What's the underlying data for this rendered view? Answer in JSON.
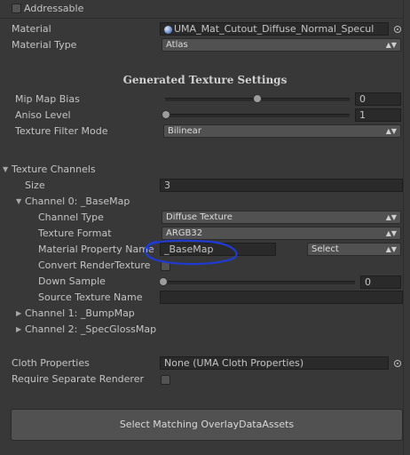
{
  "addressable": {
    "label": "Addressable",
    "checked": false
  },
  "material": {
    "label": "Material",
    "value": "UMA_Mat_Cutout_Diffuse_Normal_Specul",
    "icon": "material-sphere-icon"
  },
  "material_type": {
    "label": "Material Type",
    "value": "Atlas"
  },
  "generated_settings": {
    "title": "Generated Texture Settings",
    "mip_map_bias": {
      "label": "Mip Map Bias",
      "value": "0",
      "slider_fraction": 0.5
    },
    "aniso_level": {
      "label": "Aniso Level",
      "value": "1",
      "slider_fraction": 0.0
    },
    "texture_filter_mode": {
      "label": "Texture Filter Mode",
      "value": "Bilinear"
    }
  },
  "texture_channels": {
    "label": "Texture Channels",
    "size": {
      "label": "Size",
      "value": "3"
    },
    "channel0": {
      "label": "Channel 0: _BaseMap",
      "channel_type": {
        "label": "Channel Type",
        "value": "Diffuse Texture"
      },
      "texture_format": {
        "label": "Texture Format",
        "value": "ARGB32"
      },
      "material_property_name": {
        "label": "Material Property Name",
        "value": "_BaseMap",
        "select_label": "Select"
      },
      "convert_render_texture": {
        "label": "Convert RenderTexture",
        "checked": false
      },
      "down_sample": {
        "label": "Down Sample",
        "value": "0",
        "slider_fraction": 0.0
      },
      "source_texture_name": {
        "label": "Source Texture Name",
        "value": ""
      }
    },
    "channel1": {
      "label": "Channel 1: _BumpMap"
    },
    "channel2": {
      "label": "Channel 2: _SpecGlossMap"
    }
  },
  "cloth_properties": {
    "label": "Cloth Properties",
    "value": "None (UMA Cloth Properties)"
  },
  "require_separate_renderer": {
    "label": "Require Separate Renderer",
    "checked": false
  },
  "select_matching_button": {
    "label": "Select Matching OverlayDataAssets"
  },
  "colors": {
    "background": "#383838",
    "field": "#2a2a2a",
    "annotation": "#1f3bd6"
  }
}
